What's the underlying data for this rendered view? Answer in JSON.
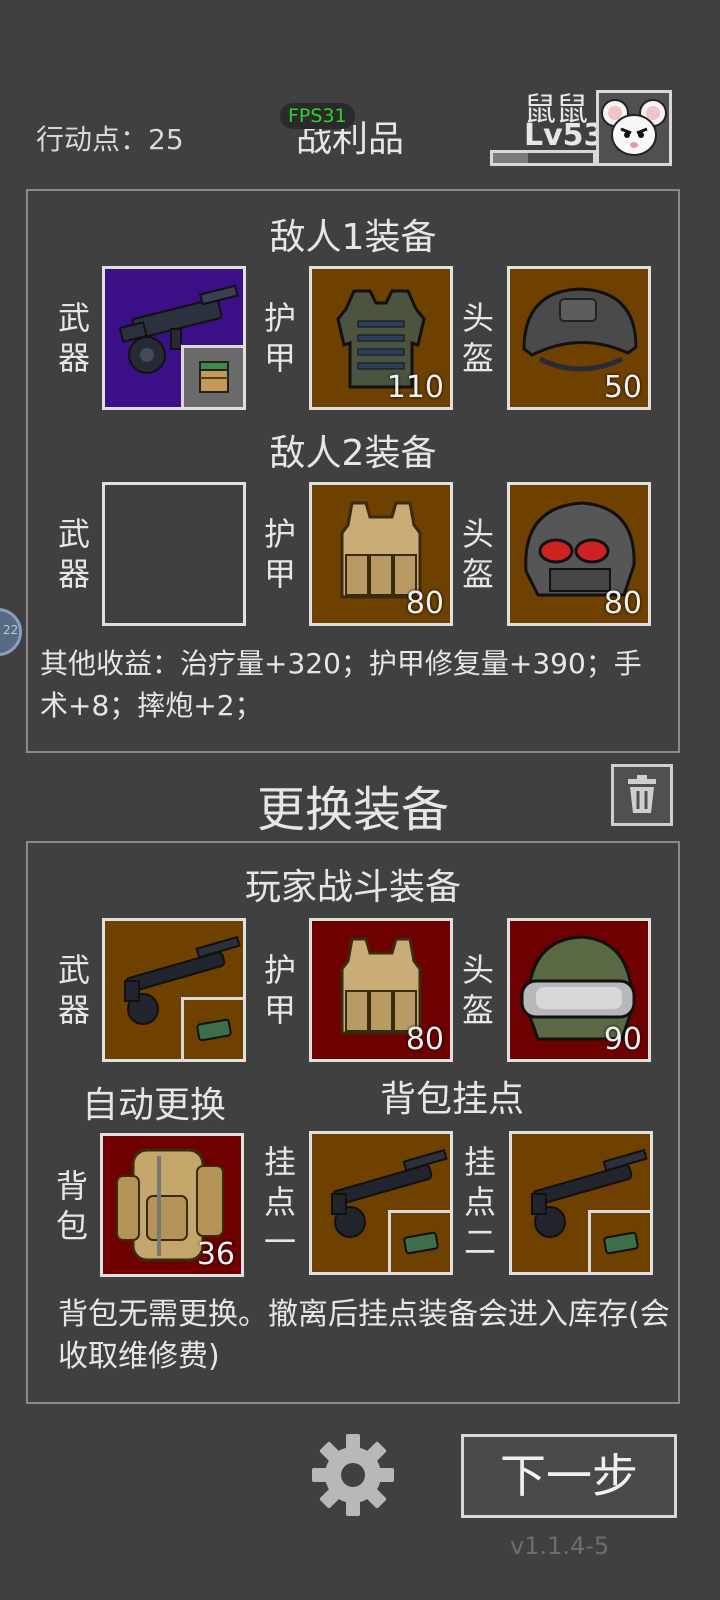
{
  "header": {
    "action_points_label": "行动点：",
    "action_points_value": "25",
    "fps": "FPS31",
    "title": "战利品",
    "player_name": "鼠鼠",
    "player_level": "Lv53",
    "xp_progress": 0.35,
    "side_badge": "22"
  },
  "loot": {
    "enemy1_title": "敌人1装备",
    "enemy2_title": "敌人2装备",
    "labels": {
      "weapon_1": "武",
      "weapon_2": "器",
      "armor_1": "护",
      "armor_2": "甲",
      "helmet_1": "头",
      "helmet_2": "盔"
    },
    "enemy1": {
      "armor_value": "110",
      "helmet_value": "50"
    },
    "enemy2": {
      "armor_value": "80",
      "helmet_value": "80"
    },
    "other_gains": "其他收益：治疗量+320；护甲修复量+390；手术+8；摔炮+2；"
  },
  "change": {
    "title": "更换装备",
    "player_title": "玩家战斗装备",
    "player": {
      "armor_value": "80",
      "helmet_value": "90"
    },
    "auto_replace": "自动更换",
    "backpack_slots_title": "背包挂点",
    "backpack_label_1": "背",
    "backpack_label_2": "包",
    "backpack_value": "36",
    "slot1_label": [
      "挂",
      "点",
      "一"
    ],
    "slot2_label": [
      "挂",
      "点",
      "二"
    ],
    "note": "背包无需更换。撤离后挂点装备会进入库存(会收取维修费)"
  },
  "footer": {
    "next_button": "下一步",
    "version": "v1.1.4-5"
  },
  "colors": {
    "background": "#404040",
    "slot_brown": "#6e4100",
    "slot_purple": "#3b0f86",
    "slot_red": "#6e0000",
    "fps_green": "#2fd12f"
  },
  "icons": [
    "gear-icon",
    "trash-icon",
    "mouse-avatar",
    "gun-icon",
    "vest-icon",
    "helmet-icon",
    "backpack-icon",
    "ammo-box-icon"
  ]
}
